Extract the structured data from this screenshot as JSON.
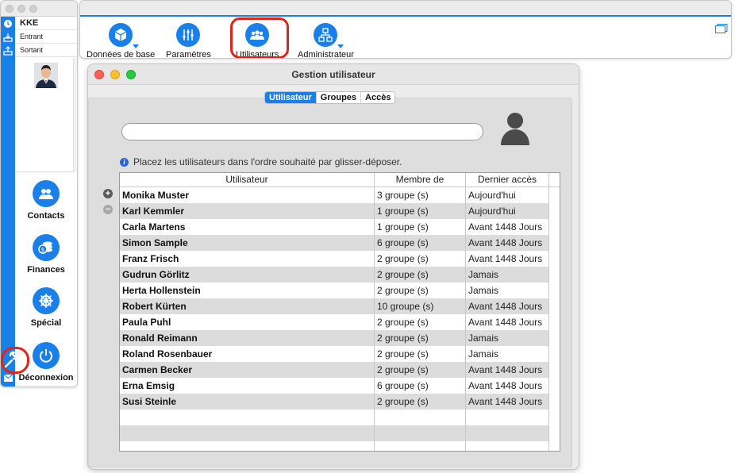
{
  "sidebar": {
    "user_code": "KKE",
    "incoming_label": "Entrant",
    "outgoing_label": "Sortant",
    "nav": [
      {
        "label": "Contacts",
        "icon": "contacts-icon"
      },
      {
        "label": "Finances",
        "icon": "finances-icon"
      },
      {
        "label": "Spécial",
        "icon": "helm-icon"
      },
      {
        "label": "Déconnexion",
        "icon": "power-icon"
      }
    ]
  },
  "toolbar": {
    "items": [
      {
        "label": "Données de base",
        "icon": "cube-icon"
      },
      {
        "label": "Paramètres",
        "icon": "sliders-icon"
      },
      {
        "label": "Utilisateurs",
        "icon": "users-icon"
      },
      {
        "label": "Administrateur",
        "icon": "network-icon"
      }
    ]
  },
  "dialog": {
    "title": "Gestion utilisateur",
    "tabs": [
      "Utilisateur",
      "Groupes",
      "Accès"
    ],
    "active_tab": "Utilisateur",
    "search_value": "",
    "info_text": "Placez les utilisateurs dans l'ordre souhaité par glisser-déposer.",
    "columns": [
      "Utilisateur",
      "Membre de",
      "Dernier accès"
    ],
    "rows": [
      {
        "name": "Monika Muster",
        "member": "3 groupe (s)",
        "last": "Aujourd'hui"
      },
      {
        "name": "Karl Kemmler",
        "member": "1 groupe (s)",
        "last": "Aujourd'hui"
      },
      {
        "name": "Carla Martens",
        "member": "1 groupe (s)",
        "last": "Avant 1448 Jours"
      },
      {
        "name": "Simon Sample",
        "member": "6 groupe (s)",
        "last": "Avant 1448 Jours"
      },
      {
        "name": "Franz Frisch",
        "member": "2 groupe (s)",
        "last": "Avant 1448 Jours"
      },
      {
        "name": "Gudrun Görlitz",
        "member": "2 groupe (s)",
        "last": "Jamais"
      },
      {
        "name": "Herta Hollenstein",
        "member": "2 groupe (s)",
        "last": "Jamais"
      },
      {
        "name": "Robert Kürten",
        "member": "10 groupe (s)",
        "last": "Avant 1448 Jours"
      },
      {
        "name": "Paula Puhl",
        "member": "2 groupe (s)",
        "last": "Avant 1448 Jours"
      },
      {
        "name": "Ronald Reimann",
        "member": "2 groupe (s)",
        "last": "Jamais"
      },
      {
        "name": "Roland Rosenbauer",
        "member": "2 groupe (s)",
        "last": "Jamais"
      },
      {
        "name": "Carmen Becker",
        "member": "2 groupe (s)",
        "last": "Avant 1448 Jours"
      },
      {
        "name": "Erna Emsig",
        "member": "6 groupe (s)",
        "last": "Avant 1448 Jours"
      },
      {
        "name": "Susi Steinle",
        "member": "2 groupe (s)",
        "last": "Avant 1448 Jours"
      }
    ],
    "empty_rows": 3
  },
  "colors": {
    "accent": "#1a7fe8",
    "highlight": "#e2231a",
    "close": "#fe5f57",
    "minimize": "#febc2e",
    "zoom": "#28c840"
  }
}
